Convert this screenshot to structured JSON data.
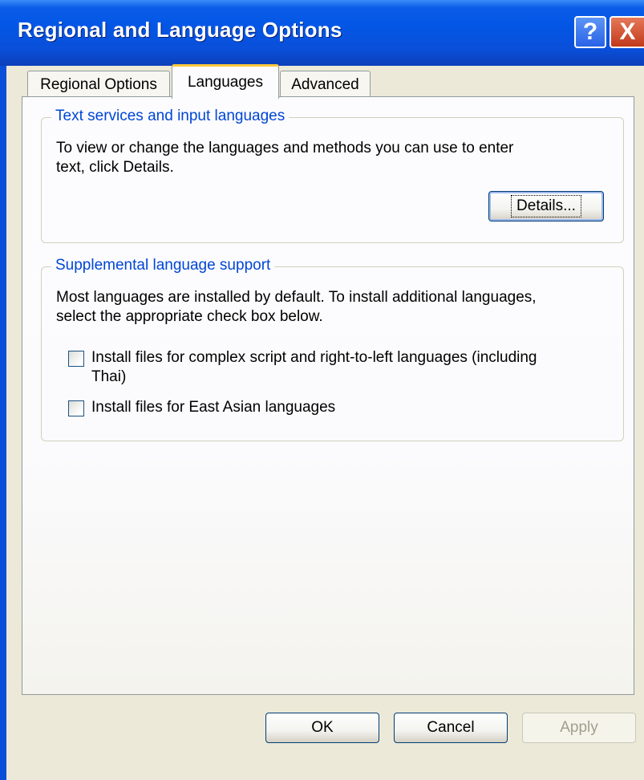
{
  "window": {
    "title": "Regional and Language Options",
    "help_glyph": "?",
    "close_glyph": "X"
  },
  "tabs": [
    {
      "label": "Regional Options",
      "selected": false
    },
    {
      "label": "Languages",
      "selected": true
    },
    {
      "label": "Advanced",
      "selected": false
    }
  ],
  "text_services": {
    "title": "Text services and input languages",
    "description_line1": "To view or change the languages and methods you can use to enter",
    "description_line2": "text, click Details.",
    "details_button": "Details..."
  },
  "supplemental": {
    "title": "Supplemental language support",
    "description_line1": "Most languages are installed by default. To install additional languages,",
    "description_line2": "select the appropriate check box below.",
    "checkboxes": [
      {
        "label_line1": "Install files for complex script and right-to-left languages (including",
        "label_line2": "Thai)",
        "checked": false
      },
      {
        "label_line1": "Install files for East Asian languages",
        "label_line2": "",
        "checked": false
      }
    ]
  },
  "buttons": {
    "ok": "OK",
    "cancel": "Cancel",
    "apply": "Apply"
  },
  "colors": {
    "titlebar": "#0356e5",
    "group_title": "#0046d5",
    "tab_highlight": "#ffc83d",
    "face": "#ece9d8"
  }
}
